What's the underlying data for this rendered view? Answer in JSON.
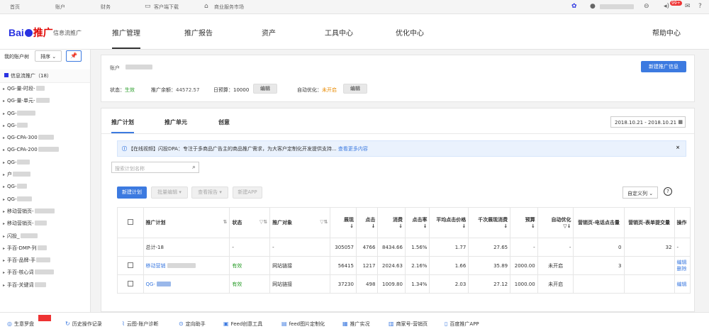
{
  "topbar": {
    "links": [
      "首页",
      "账户",
      "财务",
      "客户端下载",
      "商业服务市场"
    ],
    "badge": "99+"
  },
  "header": {
    "logo_brand": "Bai",
    "logo_suffix": "推广",
    "product_name": "信息流推广",
    "nav": [
      "推广管理",
      "推广报告",
      "资产",
      "工具中心",
      "优化中心"
    ],
    "help": "帮助中心"
  },
  "sidebar": {
    "title": "我的账户树",
    "sort_label": "排序",
    "root_label": "信息流推广（18）",
    "items": [
      "QG-量-时段-",
      "QG-量-单元-",
      "QG-",
      "QG-",
      "QG-CPA-300",
      "QG-CPA-200",
      "QG-",
      "户",
      "QG-",
      "QG-",
      "移动营销页-",
      "移动营销页-",
      "闪投_",
      "手百-DMP-列",
      "手百-品牌-手",
      "手百-核心词",
      "手百-关键词"
    ]
  },
  "account_card": {
    "account_label": "账户",
    "new_btn": "新建推广信息",
    "status_label": "状态：",
    "status_value": "生效",
    "balance_label": "推广余额：",
    "balance_value": "44572.57",
    "budget_label": "日预算：",
    "budget_value": "10000",
    "edit1": "编辑",
    "auto_label": "自动优化：",
    "auto_value": "未开启",
    "edit2": "编辑"
  },
  "main": {
    "tabs": [
      "推广计划",
      "推广单元",
      "创意"
    ],
    "date_range": "2018.10.21 - 2018.10.21",
    "notice_text": "【在线视频】闪投DPA：专注于多商品广告主的商品推广需求，为大客户定制化开发提供支持...",
    "notice_link": "查看更多内容",
    "search_placeholder": "搜索计划名称",
    "btn_new_plan": "新建计划",
    "btn_batch_edit": "批量编辑",
    "btn_view_report": "查看报告",
    "btn_new_app": "新建APP",
    "custom_columns": "自定义列"
  },
  "table": {
    "headers": [
      "推广计划",
      "状态",
      "推广对象",
      "展现",
      "点击",
      "消费",
      "点击率",
      "平均点击价格",
      "千次展现消费",
      "预算",
      "自动优化",
      "营销页-电话点击量",
      "营销页-表单提交量",
      "操作"
    ],
    "total": {
      "name": "总计-18",
      "status": "-",
      "object": "-",
      "impr": "305057",
      "clicks": "4766",
      "cost": "8434.66",
      "ctr": "1.56%",
      "cpc": "1.77",
      "cpm": "27.65",
      "budget": "-",
      "auto": "-",
      "phone": "0",
      "form": "32",
      "op": "-"
    },
    "rows": [
      {
        "name": "移动营销",
        "status": "有效",
        "object": "网站链接",
        "impr": "56415",
        "clicks": "1217",
        "cost": "2024.63",
        "ctr": "2.16%",
        "cpc": "1.66",
        "cpm": "35.89",
        "budget": "2000.00",
        "auto": "未开启",
        "phone": "3",
        "form": "",
        "op1": "编辑",
        "op2": "删除"
      },
      {
        "name": "QG-",
        "status": "有效",
        "object": "网站链接",
        "impr": "37230",
        "clicks": "498",
        "cost": "1009.80",
        "ctr": "1.34%",
        "cpc": "2.03",
        "cpm": "27.12",
        "budget": "1000.00",
        "auto": "未开启",
        "phone": "",
        "form": "",
        "op1": "编辑",
        "op2": ""
      }
    ]
  },
  "bottombar": {
    "items": [
      "生意罗盘",
      "历史操作记录",
      "云图-账户诊断",
      "定向助手",
      "Feed创意工具",
      "feed图片定制化",
      "推广实况",
      "商家号-营销页",
      "百度推广APP"
    ]
  }
}
